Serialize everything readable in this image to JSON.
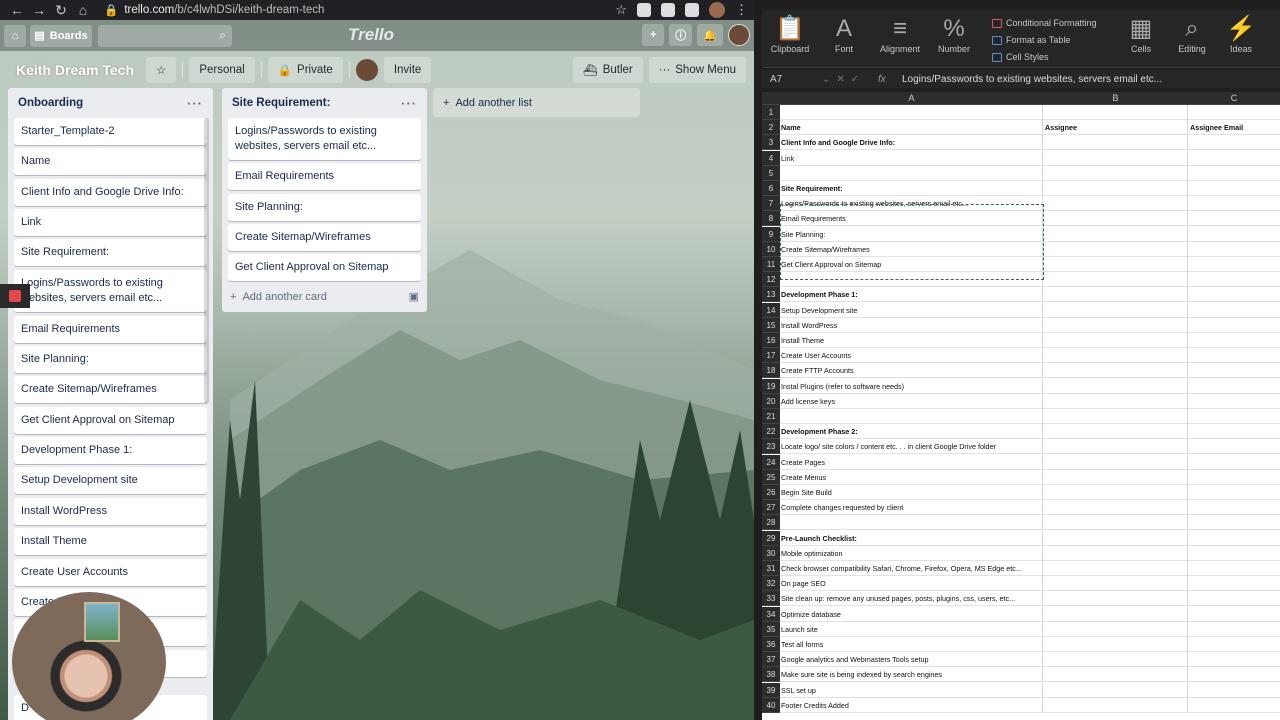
{
  "browser": {
    "url_host": "trello.com",
    "url_path": "/b/c4lwhDSi/keith-dream-tech"
  },
  "trello": {
    "header": {
      "boards_label": "Boards",
      "logo": "Trello"
    },
    "board": {
      "title": "Keith Dream Tech",
      "personal_label": "Personal",
      "private_label": "Private",
      "invite_label": "Invite",
      "butler_label": "Butler",
      "show_menu_label": "Show Menu"
    },
    "lists": [
      {
        "title": "Onboarding",
        "cards": [
          "Starter_Template-2",
          "Name",
          "Client Info and Google Drive Info:",
          "Link",
          "Site Requirement:",
          "Logins/Passwords to existing websites, servers email etc...",
          "Email Requirements",
          "Site Planning:",
          "Create Sitemap/Wireframes",
          "Get Client Approval on Sitemap",
          "Development Phase 1:",
          "Setup Development site",
          "Install WordPress",
          "Install Theme",
          "Create User Accounts",
          "Create F",
          "In",
          "",
          "D"
        ]
      },
      {
        "title": "Site Requirement:",
        "cards": [
          "Logins/Passwords to existing websites, servers email etc...",
          "Email Requirements",
          "Site Planning:",
          "Create Sitemap/Wireframes",
          "Get Client Approval on Sitemap"
        ],
        "add_card_label": "Add another card"
      }
    ],
    "add_list_label": "Add another list"
  },
  "excel": {
    "ribbon": {
      "clipboard": "Clipboard",
      "font": "Font",
      "alignment": "Alignment",
      "number": "Number",
      "conditional_formatting": "Conditional Formatting",
      "format_as_table": "Format as Table",
      "cell_styles": "Cell Styles",
      "cells": "Cells",
      "editing": "Editing",
      "ideas": "Ideas"
    },
    "cell_ref": "A7",
    "formula": "Logins/Passwords to existing websites, servers email etc...",
    "columns": [
      "A",
      "B",
      "C"
    ],
    "rows": [
      {
        "n": "1",
        "a": ""
      },
      {
        "n": "2",
        "a": "Name",
        "bold": true,
        "b": "Assignee",
        "c": "Assignee Email"
      },
      {
        "n": "3",
        "a": "Client Info and Google Drive Info:",
        "bold": true
      },
      {
        "n": "4",
        "a": "Link"
      },
      {
        "n": "5",
        "a": ""
      },
      {
        "n": "6",
        "a": "Site Requirement:",
        "bold": true
      },
      {
        "n": "7",
        "a": "Logins/Passwords to existing websites, servers email etc..."
      },
      {
        "n": "8",
        "a": "Email Requirements"
      },
      {
        "n": "9",
        "a": "Site Planning:"
      },
      {
        "n": "10",
        "a": "Create Sitemap/Wireframes"
      },
      {
        "n": "11",
        "a": "Get Client Approval on Sitemap"
      },
      {
        "n": "12",
        "a": ""
      },
      {
        "n": "13",
        "a": "Development Phase 1:",
        "bold": true
      },
      {
        "n": "14",
        "a": "Setup Development site"
      },
      {
        "n": "15",
        "a": "Install WordPress"
      },
      {
        "n": "16",
        "a": "Install Theme"
      },
      {
        "n": "17",
        "a": "Create User Accounts"
      },
      {
        "n": "18",
        "a": "Create FTTP Accounts"
      },
      {
        "n": "19",
        "a": "Instal Plugins (refer to software needs)"
      },
      {
        "n": "20",
        "a": "Add license keys"
      },
      {
        "n": "21",
        "a": ""
      },
      {
        "n": "22",
        "a": "Development Phase 2:",
        "bold": true
      },
      {
        "n": "23",
        "a": "Locate logo/ site colors / content etc. . . in client Google Drive folder"
      },
      {
        "n": "24",
        "a": "Create Pages"
      },
      {
        "n": "25",
        "a": "Create Menus"
      },
      {
        "n": "26",
        "a": "Begin Site Build"
      },
      {
        "n": "27",
        "a": "Complete changes requested by client"
      },
      {
        "n": "28",
        "a": ""
      },
      {
        "n": "29",
        "a": "Pre-Launch Checklist:",
        "bold": true
      },
      {
        "n": "30",
        "a": "Mobile optimization"
      },
      {
        "n": "31",
        "a": "Check browser compatibility Safari, Chrome, Firefox, Opera, MS Edge etc..."
      },
      {
        "n": "32",
        "a": "On page SEO"
      },
      {
        "n": "33",
        "a": "Site clean up: remove any unused pages, posts, plugins, css, users, etc..."
      },
      {
        "n": "34",
        "a": "Optimize database"
      },
      {
        "n": "35",
        "a": "Launch site"
      },
      {
        "n": "36",
        "a": "Test all forms"
      },
      {
        "n": "37",
        "a": "Google analytics and Webmasters Tools setup"
      },
      {
        "n": "38",
        "a": "Make sure site is being indexed by search engines"
      },
      {
        "n": "39",
        "a": "SSL set up"
      },
      {
        "n": "40",
        "a": "Footer Credits Added"
      }
    ]
  }
}
